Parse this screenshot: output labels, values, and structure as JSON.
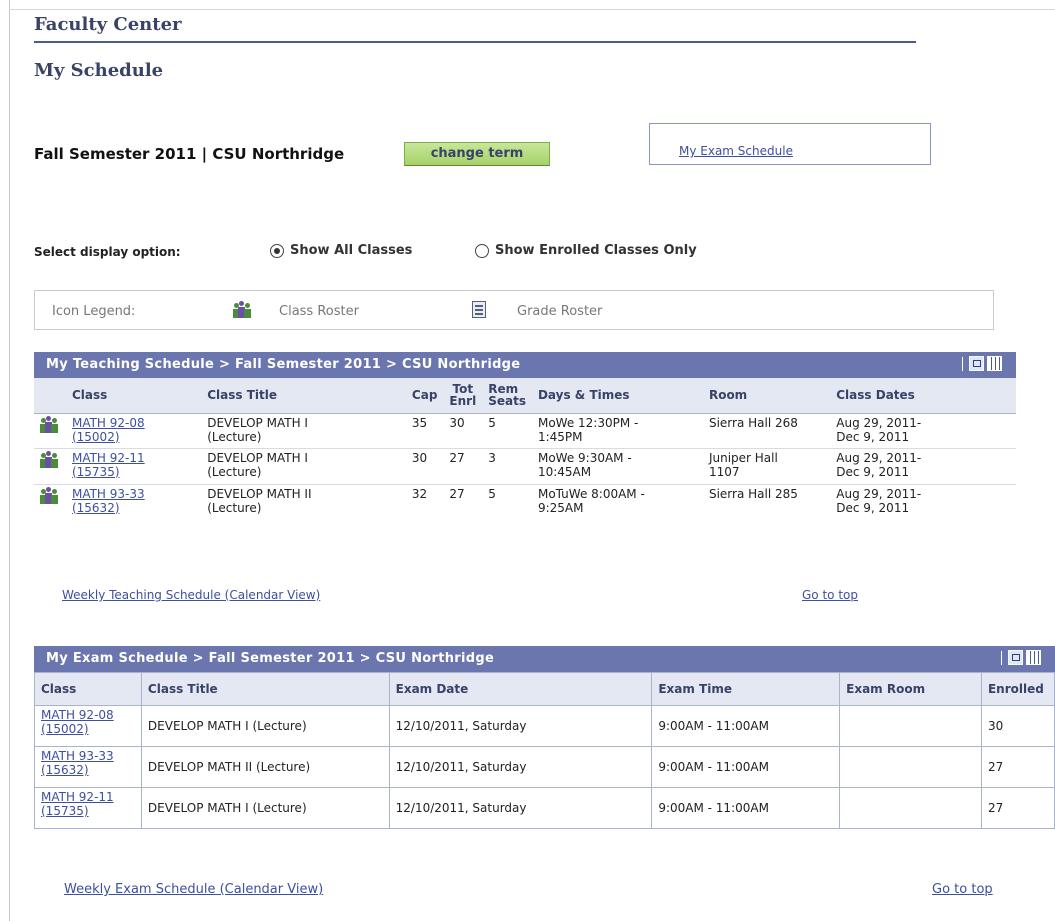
{
  "page": {
    "header_title": "Faculty Center",
    "page_title": "My Schedule"
  },
  "term": {
    "label": "Fall Semester 2011 | CSU Northridge",
    "change_button": "change term",
    "exam_schedule_link": "My Exam Schedule"
  },
  "display": {
    "label": "Select display option:",
    "option_all": "Show All Classes",
    "option_enrolled": "Show Enrolled Classes Only",
    "selected": "Show All Classes"
  },
  "legend": {
    "label": "Icon Legend:",
    "class_roster": "Class Roster",
    "grade_roster": "Grade Roster",
    "class_roster_icon": "people-icon",
    "grade_roster_icon": "grade-roster-icon"
  },
  "teaching": {
    "title": "My Teaching Schedule > Fall Semester 2011 > CSU Northridge",
    "columns": {
      "class": "Class",
      "title": "Class Title",
      "cap": "Cap",
      "tot_1": "Tot",
      "tot_2": "Enrl",
      "rem_1": "Rem",
      "rem_2": "Seats",
      "days": "Days & Times",
      "room": "Room",
      "dates": "Class Dates"
    },
    "rows": [
      {
        "class_1": "MATH 92-08",
        "class_2": "(15002)",
        "title_1": "DEVELOP MATH I",
        "title_2": "(Lecture)",
        "cap": "35",
        "tot": "30",
        "rem": "5",
        "days_1": "MoWe 12:30PM -",
        "days_2": "1:45PM",
        "room_1": "Sierra Hall 268",
        "room_2": "",
        "dates_1": "Aug 29, 2011-",
        "dates_2": "Dec 9, 2011"
      },
      {
        "class_1": "MATH 92-11",
        "class_2": "(15735)",
        "title_1": "DEVELOP MATH I",
        "title_2": "(Lecture)",
        "cap": "30",
        "tot": "27",
        "rem": "3",
        "days_1": "MoWe 9:30AM -",
        "days_2": "10:45AM",
        "room_1": "Juniper Hall",
        "room_2": "1107",
        "dates_1": "Aug 29, 2011-",
        "dates_2": "Dec 9, 2011"
      },
      {
        "class_1": "MATH 93-33",
        "class_2": "(15632)",
        "title_1": "DEVELOP MATH II",
        "title_2": "(Lecture)",
        "cap": "32",
        "tot": "27",
        "rem": "5",
        "days_1": "MoTuWe 8:00AM -",
        "days_2": "9:25AM",
        "room_1": "Sierra Hall 285",
        "room_2": "",
        "dates_1": "Aug 29, 2011-",
        "dates_2": "Dec 9, 2011"
      }
    ],
    "calendar_link": "Weekly Teaching Schedule (Calendar View)",
    "top_link": "Go to top"
  },
  "exam": {
    "title": "My Exam Schedule > Fall Semester 2011 > CSU Northridge",
    "columns": {
      "class": "Class",
      "title": "Class Title",
      "date": "Exam Date",
      "time": "Exam Time",
      "room": "Exam Room",
      "enrolled": "Enrolled"
    },
    "rows": [
      {
        "class_1": "MATH 92-08",
        "class_2": "(15002)",
        "title": "DEVELOP MATH I (Lecture)",
        "date": "12/10/2011, Saturday",
        "time": "9:00AM - 11:00AM",
        "room": "",
        "enrolled": "30"
      },
      {
        "class_1": "MATH 93-33",
        "class_2": "(15632)",
        "title": "DEVELOP MATH II (Lecture)",
        "date": "12/10/2011, Saturday",
        "time": "9:00AM - 11:00AM",
        "room": "",
        "enrolled": "27"
      },
      {
        "class_1": "MATH 92-11",
        "class_2": "(15735)",
        "title": "DEVELOP MATH I (Lecture)",
        "date": "12/10/2011, Saturday",
        "time": "9:00AM - 11:00AM",
        "room": "",
        "enrolled": "27"
      }
    ],
    "calendar_link": "Weekly Exam Schedule (Calendar View)",
    "top_link": "Go to top"
  },
  "colors": {
    "grid_header": "#6b76ae",
    "link": "#3d4fa0",
    "button": "#a6d269",
    "title": "#394267"
  }
}
